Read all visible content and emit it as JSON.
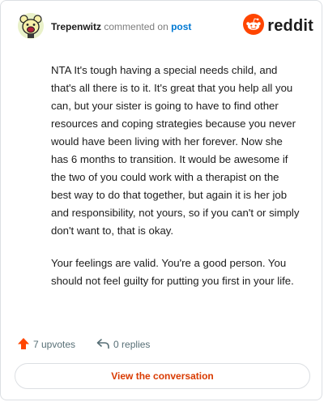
{
  "header": {
    "author": "Trepenwitz",
    "action": "commented on",
    "post_link": "post",
    "brand": "reddit"
  },
  "comment": {
    "paragraphs": [
      "NTA It's tough having a special needs child, and that's all there is to it. It's great that you help all you can, but your sister is going to have to find other resources and coping strategies because you never would have been living with her forever. Now she has 6 months to transition. It would be awesome if the two of you could work with a therapist on the best way to do that together, but again it is her job and responsibility, not yours, so if you can't or simply don't want to, that is okay.",
      "Your feelings are valid. You're a good person. You should not feel guilty for putting you first in your life."
    ]
  },
  "footer": {
    "upvotes": "7 upvotes",
    "replies": "0 replies"
  },
  "cta": {
    "label": "View the conversation"
  },
  "colors": {
    "accent": "#d93a00",
    "upvote": "#ff4500",
    "link": "#0079d3",
    "border": "#dcdfe3"
  },
  "icons": {
    "avatar": "avatar-icon",
    "brand": "reddit-logo-icon",
    "upvote": "upvote-arrow-icon",
    "reply": "reply-arrow-icon"
  }
}
